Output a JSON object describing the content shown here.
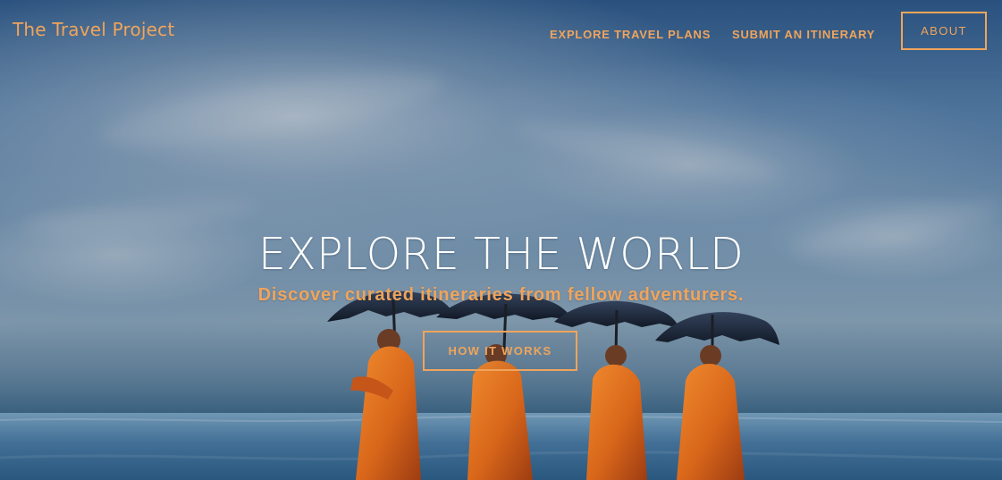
{
  "app": {
    "brand": "The Travel Project"
  },
  "navigation": {
    "items": [
      {
        "label": "EXPLORE TRAVEL PLANS"
      },
      {
        "label": "SUBMIT AN ITINERARY"
      },
      {
        "label": "ABOUT"
      }
    ]
  },
  "hero": {
    "headline": "EXPLORE THE WORLD",
    "subheadline": "Discover curated itineraries from fellow adventurers.",
    "cta_label": "HOW IT WORKS"
  },
  "colors": {
    "accent": "#f0a45b",
    "headline": "#ffffff",
    "sky": "#5b86b4",
    "sea": "#2f5c82",
    "robe": "#d9691b",
    "umbrella": "#1b2435"
  },
  "background": {
    "subject_icons": [
      "monk-figure-icon",
      "black-umbrella-icon"
    ]
  }
}
